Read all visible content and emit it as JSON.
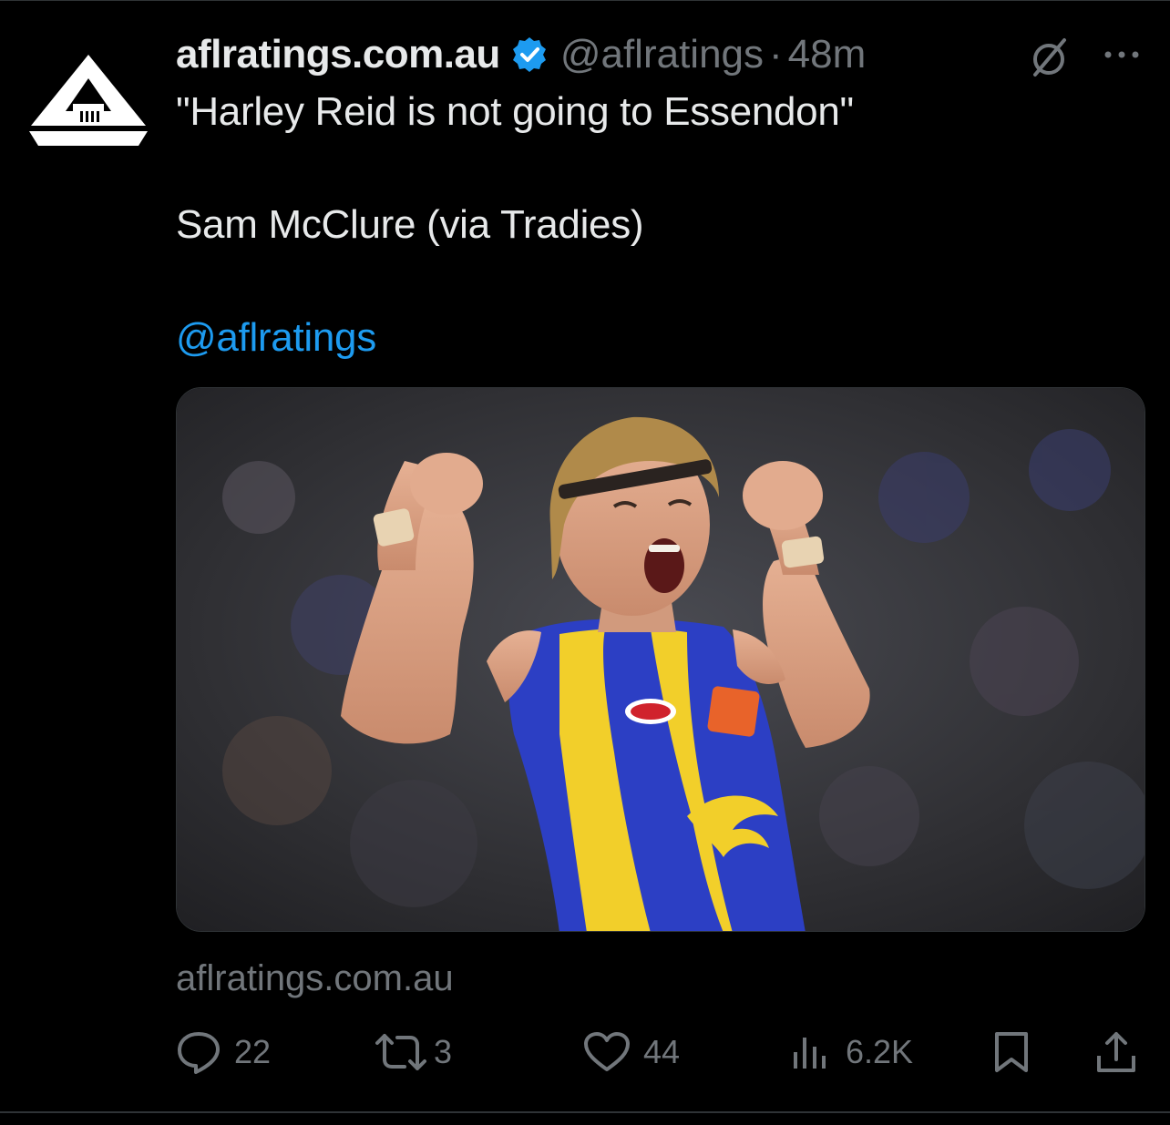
{
  "tweet": {
    "display_name": "aflratings.com.au",
    "handle": "@aflratings",
    "separator": "·",
    "time": "48m",
    "lines": [
      "\"Harley Reid is not going to Essendon\"",
      "Sam McClure (via Tradies)"
    ],
    "mention": "@aflratings",
    "source_domain": "aflratings.com.au"
  },
  "avatar": {
    "icon": "aflratings-logo-icon"
  },
  "actions": {
    "replies": "22",
    "reposts": "3",
    "likes": "44",
    "views": "6.2K"
  },
  "icons": {
    "verified": "verified-badge-icon",
    "grok": "grok-icon",
    "more": "more-icon",
    "reply": "reply-icon",
    "repost": "repost-icon",
    "like": "like-icon",
    "views": "views-icon",
    "bookmark": "bookmark-icon",
    "share": "share-icon"
  },
  "colors": {
    "background": "#000000",
    "text_primary": "#e7e9ea",
    "text_secondary": "#71767b",
    "link": "#1d9bf0",
    "verified": "#1d9bf0"
  }
}
